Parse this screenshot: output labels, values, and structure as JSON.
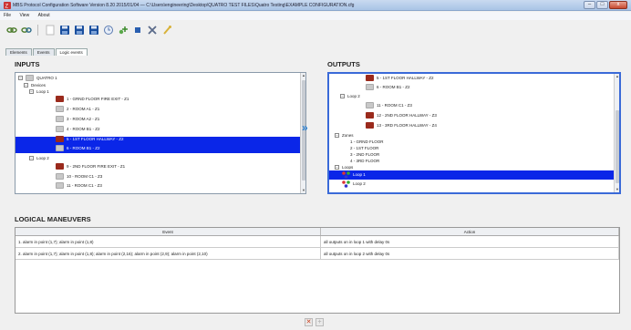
{
  "window": {
    "title": "MBS Protocol Configuration Software Version 8.20 2015/01/04 — C:\\Users\\engineering\\Desktop\\QUATRO TEST FILES\\Quatro Testing\\EXAMPLE CONFIGURATION.cfg",
    "min": "–",
    "max": "□",
    "close": "x"
  },
  "menu": [
    "File",
    "View",
    "About"
  ],
  "tabs": [
    "Elements",
    "Events",
    "Logic events"
  ],
  "inputs": {
    "label": "INPUTS",
    "root": "QUATRO 1",
    "devices": "Devices",
    "loop1": "Loop 1",
    "items1": [
      "1 - GRND FLOOR FIRE EXIT - Z1",
      "2 - ROOM A1 - Z1",
      "3 - ROOM A2 - Z1",
      "4 - ROOM B1 - Z2",
      "5 - 1ST FLOOR HALLWAY - Z2",
      "6 - ROOM B1 - Z2"
    ],
    "loop2": "Loop 2",
    "items2": [
      "9 - 2ND FLOOR FIRE EXIT - Z1",
      "10 - ROOM C1 - Z3",
      "11 - ROOM C1 - Z3"
    ]
  },
  "outputs": {
    "label": "OUTPUTS",
    "items1": [
      "5 - 1ST FLOOR HALLWAY - Z2",
      "6 - ROOM B1 - Z2"
    ],
    "loop2": "Loop 2",
    "items2": [
      "11 - ROOM C1 - Z3",
      "12 - 2ND FLOOR HALLWAY - Z3",
      "13 - 3RD FLOOR HALLWAY - Z4"
    ],
    "zones": "Zones",
    "zone_items": [
      "1 - GRND FLOOR",
      "2 - 1ST FLOOR",
      "3 - 2ND FLOOR",
      "4 - 3RD FLOOR"
    ],
    "loops": "Loops",
    "loop_items": [
      "Loop 1",
      "Loop 2"
    ]
  },
  "transfer_icon": "double-chevron-right",
  "logical": {
    "label": "LOGICAL MANEUVERS",
    "columns": [
      "Event",
      "Action"
    ],
    "rows": [
      {
        "event": "1. alarm in point (1,7); alarm in point (1,8)",
        "action": "all outputs on in loop 1 with delay 0s"
      },
      {
        "event": "2. alarm in point (1,7); alarm in point (1,8); alarm in point (2,16); alarm in point (2,9); alarm in point (2,10)",
        "action": "all outputs on in loop 2 with delay 0s"
      }
    ]
  },
  "footer": {
    "delete": "✕",
    "add": "+"
  },
  "colors": {
    "selection": "#0a26e8",
    "device_red": "#9a2a1c",
    "accent": "#2a7fd0"
  }
}
